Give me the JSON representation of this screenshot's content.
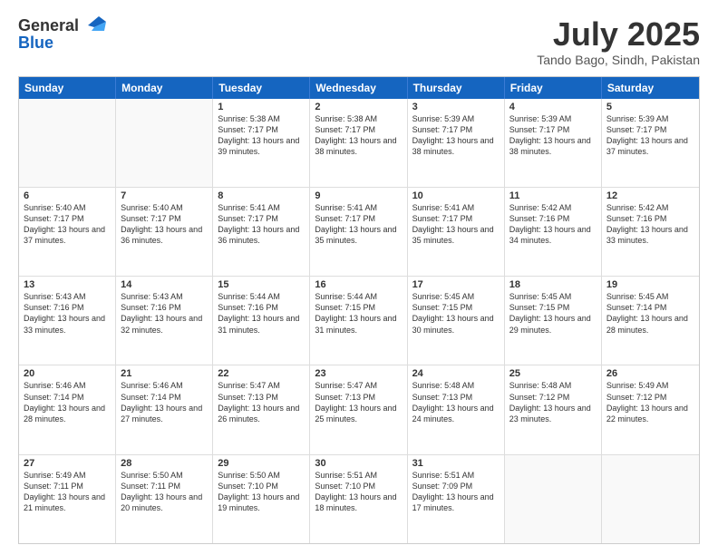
{
  "header": {
    "logo_general": "General",
    "logo_blue": "Blue",
    "month_title": "July 2025",
    "location": "Tando Bago, Sindh, Pakistan"
  },
  "weekdays": [
    "Sunday",
    "Monday",
    "Tuesday",
    "Wednesday",
    "Thursday",
    "Friday",
    "Saturday"
  ],
  "rows": [
    [
      {
        "day": "",
        "info": ""
      },
      {
        "day": "",
        "info": ""
      },
      {
        "day": "1",
        "info": "Sunrise: 5:38 AM\nSunset: 7:17 PM\nDaylight: 13 hours and 39 minutes."
      },
      {
        "day": "2",
        "info": "Sunrise: 5:38 AM\nSunset: 7:17 PM\nDaylight: 13 hours and 38 minutes."
      },
      {
        "day": "3",
        "info": "Sunrise: 5:39 AM\nSunset: 7:17 PM\nDaylight: 13 hours and 38 minutes."
      },
      {
        "day": "4",
        "info": "Sunrise: 5:39 AM\nSunset: 7:17 PM\nDaylight: 13 hours and 38 minutes."
      },
      {
        "day": "5",
        "info": "Sunrise: 5:39 AM\nSunset: 7:17 PM\nDaylight: 13 hours and 37 minutes."
      }
    ],
    [
      {
        "day": "6",
        "info": "Sunrise: 5:40 AM\nSunset: 7:17 PM\nDaylight: 13 hours and 37 minutes."
      },
      {
        "day": "7",
        "info": "Sunrise: 5:40 AM\nSunset: 7:17 PM\nDaylight: 13 hours and 36 minutes."
      },
      {
        "day": "8",
        "info": "Sunrise: 5:41 AM\nSunset: 7:17 PM\nDaylight: 13 hours and 36 minutes."
      },
      {
        "day": "9",
        "info": "Sunrise: 5:41 AM\nSunset: 7:17 PM\nDaylight: 13 hours and 35 minutes."
      },
      {
        "day": "10",
        "info": "Sunrise: 5:41 AM\nSunset: 7:17 PM\nDaylight: 13 hours and 35 minutes."
      },
      {
        "day": "11",
        "info": "Sunrise: 5:42 AM\nSunset: 7:16 PM\nDaylight: 13 hours and 34 minutes."
      },
      {
        "day": "12",
        "info": "Sunrise: 5:42 AM\nSunset: 7:16 PM\nDaylight: 13 hours and 33 minutes."
      }
    ],
    [
      {
        "day": "13",
        "info": "Sunrise: 5:43 AM\nSunset: 7:16 PM\nDaylight: 13 hours and 33 minutes."
      },
      {
        "day": "14",
        "info": "Sunrise: 5:43 AM\nSunset: 7:16 PM\nDaylight: 13 hours and 32 minutes."
      },
      {
        "day": "15",
        "info": "Sunrise: 5:44 AM\nSunset: 7:16 PM\nDaylight: 13 hours and 31 minutes."
      },
      {
        "day": "16",
        "info": "Sunrise: 5:44 AM\nSunset: 7:15 PM\nDaylight: 13 hours and 31 minutes."
      },
      {
        "day": "17",
        "info": "Sunrise: 5:45 AM\nSunset: 7:15 PM\nDaylight: 13 hours and 30 minutes."
      },
      {
        "day": "18",
        "info": "Sunrise: 5:45 AM\nSunset: 7:15 PM\nDaylight: 13 hours and 29 minutes."
      },
      {
        "day": "19",
        "info": "Sunrise: 5:45 AM\nSunset: 7:14 PM\nDaylight: 13 hours and 28 minutes."
      }
    ],
    [
      {
        "day": "20",
        "info": "Sunrise: 5:46 AM\nSunset: 7:14 PM\nDaylight: 13 hours and 28 minutes."
      },
      {
        "day": "21",
        "info": "Sunrise: 5:46 AM\nSunset: 7:14 PM\nDaylight: 13 hours and 27 minutes."
      },
      {
        "day": "22",
        "info": "Sunrise: 5:47 AM\nSunset: 7:13 PM\nDaylight: 13 hours and 26 minutes."
      },
      {
        "day": "23",
        "info": "Sunrise: 5:47 AM\nSunset: 7:13 PM\nDaylight: 13 hours and 25 minutes."
      },
      {
        "day": "24",
        "info": "Sunrise: 5:48 AM\nSunset: 7:13 PM\nDaylight: 13 hours and 24 minutes."
      },
      {
        "day": "25",
        "info": "Sunrise: 5:48 AM\nSunset: 7:12 PM\nDaylight: 13 hours and 23 minutes."
      },
      {
        "day": "26",
        "info": "Sunrise: 5:49 AM\nSunset: 7:12 PM\nDaylight: 13 hours and 22 minutes."
      }
    ],
    [
      {
        "day": "27",
        "info": "Sunrise: 5:49 AM\nSunset: 7:11 PM\nDaylight: 13 hours and 21 minutes."
      },
      {
        "day": "28",
        "info": "Sunrise: 5:50 AM\nSunset: 7:11 PM\nDaylight: 13 hours and 20 minutes."
      },
      {
        "day": "29",
        "info": "Sunrise: 5:50 AM\nSunset: 7:10 PM\nDaylight: 13 hours and 19 minutes."
      },
      {
        "day": "30",
        "info": "Sunrise: 5:51 AM\nSunset: 7:10 PM\nDaylight: 13 hours and 18 minutes."
      },
      {
        "day": "31",
        "info": "Sunrise: 5:51 AM\nSunset: 7:09 PM\nDaylight: 13 hours and 17 minutes."
      },
      {
        "day": "",
        "info": ""
      },
      {
        "day": "",
        "info": ""
      }
    ]
  ]
}
